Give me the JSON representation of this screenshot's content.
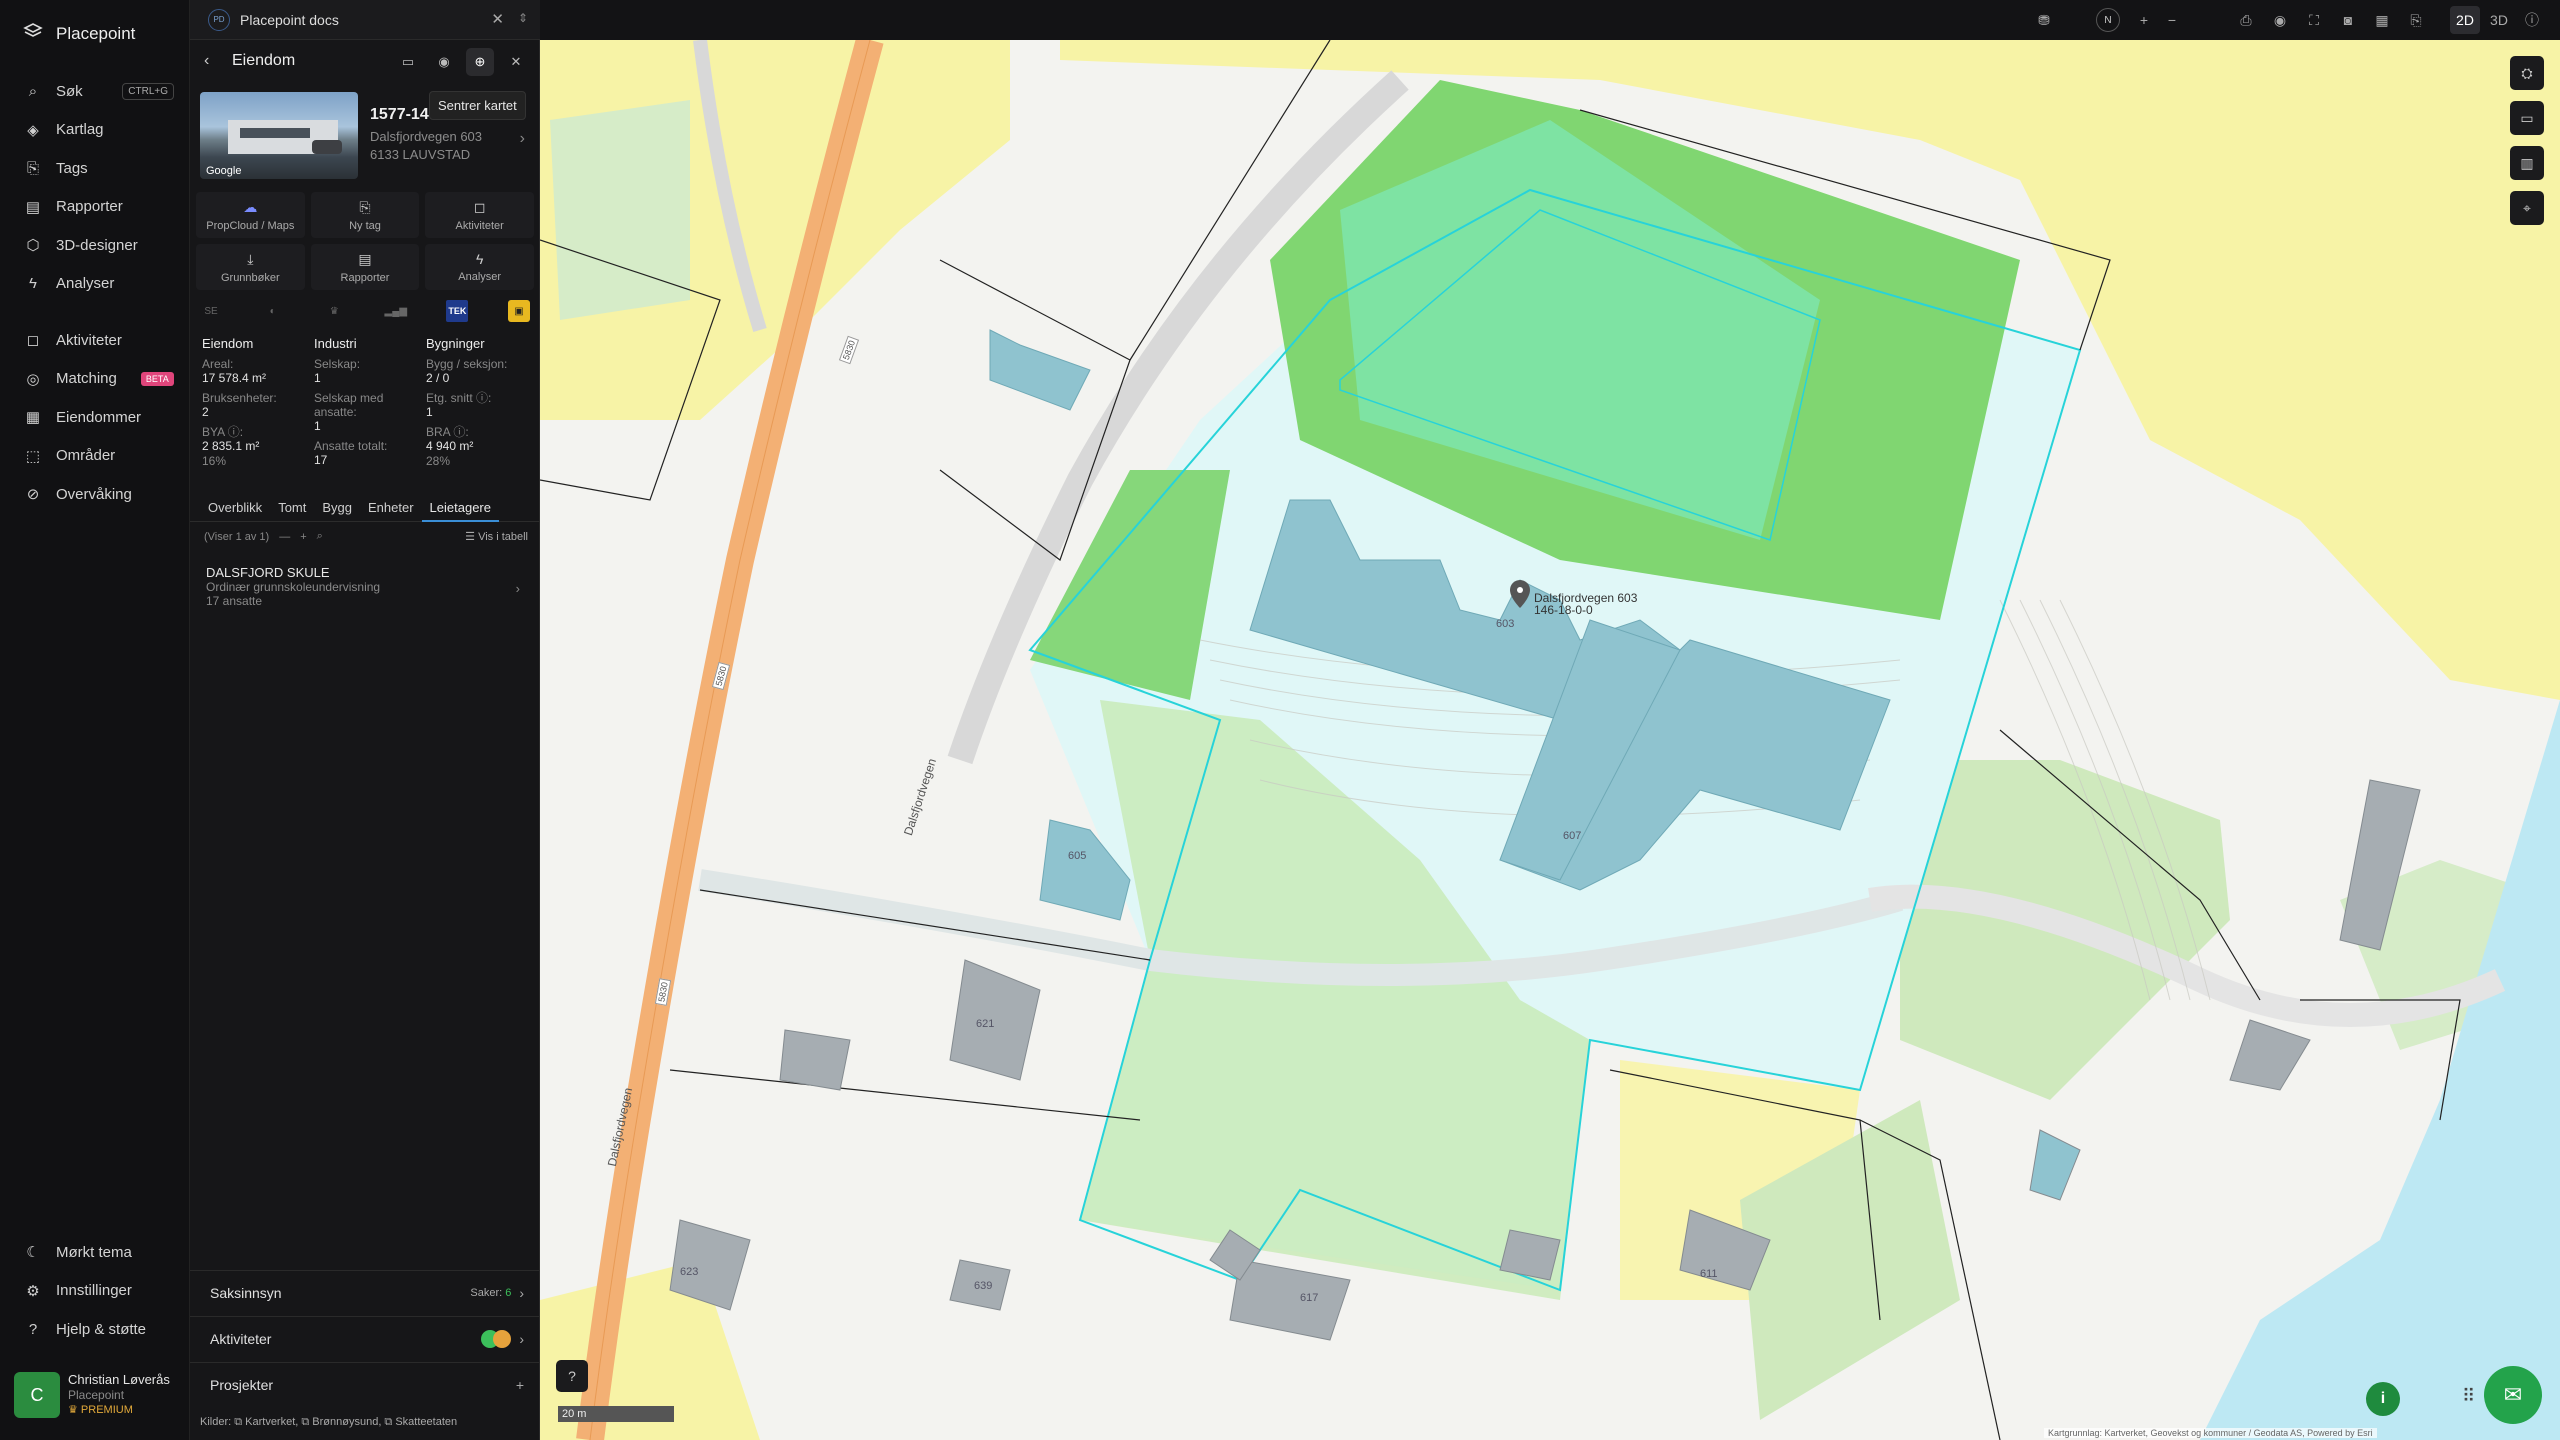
{
  "app": {
    "name": "Placepoint"
  },
  "nav": {
    "items": [
      {
        "label": "Søk",
        "icon": "search-icon",
        "kbd": "CTRL+G"
      },
      {
        "label": "Kartlag",
        "icon": "layers-icon"
      },
      {
        "label": "Tags",
        "icon": "bookmark-icon"
      },
      {
        "label": "Rapporter",
        "icon": "chart-icon"
      },
      {
        "label": "3D-designer",
        "icon": "cube-icon"
      },
      {
        "label": "Analyser",
        "icon": "bolt-icon"
      }
    ],
    "items2": [
      {
        "label": "Aktiviteter",
        "icon": "chat-icon"
      },
      {
        "label": "Matching",
        "icon": "target-icon",
        "badge": "BETA"
      },
      {
        "label": "Eiendommer",
        "icon": "building-icon"
      },
      {
        "label": "Områder",
        "icon": "area-icon"
      },
      {
        "label": "Overvåking",
        "icon": "check-circle-icon"
      }
    ],
    "bottom": [
      {
        "label": "Mørkt tema",
        "icon": "moon-icon"
      },
      {
        "label": "Innstillinger",
        "icon": "gear-icon"
      },
      {
        "label": "Hjelp & støtte",
        "icon": "help-icon"
      }
    ],
    "user": {
      "initial": "C",
      "name": "Christian Løverås",
      "org": "Placepoint",
      "plan": "PREMIUM"
    }
  },
  "doc_tab": {
    "logo": "PD",
    "title": "Placepoint docs"
  },
  "panel": {
    "title": "Eiendom",
    "tooltip": "Sentrer kartet",
    "property_id": "1577-146-18-0-0",
    "address_line1": "Dalsfjordvegen 603",
    "address_line2": "6133 LAUVSTAD",
    "photo_label": "Google",
    "actions": [
      {
        "label": "PropCloud / Maps",
        "icon": "cloud-icon"
      },
      {
        "label": "Ny tag",
        "icon": "bookmark-icon"
      },
      {
        "label": "Aktiviteter",
        "icon": "chat-icon"
      },
      {
        "label": "Grunnbøker",
        "icon": "download-icon"
      },
      {
        "label": "Rapporter",
        "icon": "chart-icon"
      },
      {
        "label": "Analyser",
        "icon": "bolt-icon"
      }
    ],
    "logos": [
      "SE",
      "◐",
      "♛",
      "▂▄▆",
      "TEK",
      "▣"
    ],
    "stats": {
      "eiendom": {
        "h": "Eiendom",
        "areal_l": "Areal:",
        "areal_v": "17 578.4 m²",
        "bruks_l": "Bruksenheter:",
        "bruks_v": "2",
        "bya_l": "BYA ⓘ:",
        "bya_v": "2 835.1 m²",
        "bya_p": "16%"
      },
      "industri": {
        "h": "Industri",
        "sel_l": "Selskap:",
        "sel_v": "1",
        "sma_l1": "Selskap med",
        "sma_l2": "ansatte:",
        "sma_v": "1",
        "ans_l": "Ansatte totalt:",
        "ans_v": "17"
      },
      "bygninger": {
        "h": "Bygninger",
        "bs_l": "Bygg / seksjon:",
        "bs_v": "2 / 0",
        "etg_l": "Etg. snitt ⓘ:",
        "etg_v": "1",
        "bra_l": "BRA ⓘ:",
        "bra_v": "4 940 m²",
        "bra_p": "28%"
      }
    },
    "tabs": [
      "Overblikk",
      "Tomt",
      "Bygg",
      "Enheter",
      "Leietagere"
    ],
    "active_tab": "Leietagere",
    "table_bar": {
      "count": "(Viser 1 av 1)",
      "view": "Vis i tabell"
    },
    "tenant": {
      "name": "DALSFJORD SKULE",
      "desc": "Ordinær grunnskoleundervisning",
      "employees": "17 ansatte"
    },
    "sections": [
      {
        "label": "Saksinnsyn",
        "right_prefix": "Saker:",
        "right_value": "6"
      },
      {
        "label": "Aktiviteter"
      },
      {
        "label": "Prosjekter",
        "right_value": "+"
      }
    ],
    "sources": "Kilder: ⧉ Kartverket, ⧉ Brønnøysund, ⧉ Skatteetaten"
  },
  "map": {
    "marker_address": "Dalsfjordvegen 603",
    "marker_gnr": "146-18-0-0",
    "road_name": "Dalsfjordvegen",
    "road_number": "5830",
    "house_numbers": [
      "603",
      "605",
      "607",
      "621",
      "623",
      "639",
      "617",
      "611"
    ],
    "scale": "20 m",
    "attribution": "Kartgrunnlag: Kartverket, Geovekst og kommuner / Geodata AS, Powered by Esri"
  },
  "toolbar": {
    "north": "N",
    "mode_2d": "2D",
    "mode_3d": "3D"
  },
  "colors": {
    "accent": "#3a8ed6",
    "green": "#23a34b",
    "parcel": "#27d3d9"
  }
}
